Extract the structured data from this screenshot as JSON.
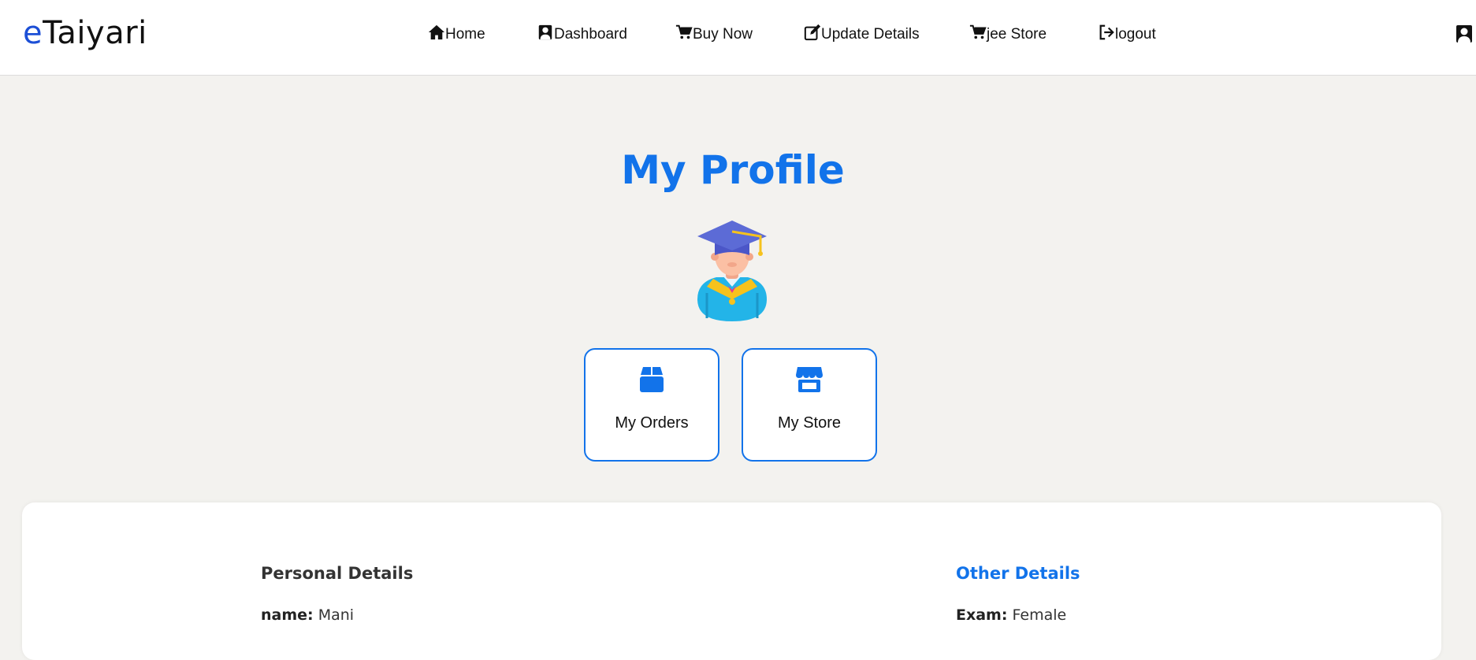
{
  "brand": {
    "logo_prefix": "e",
    "logo_rest": "Taiyari",
    "accent_color": "#1273ea",
    "logo_color": "#1c4fd6"
  },
  "nav": {
    "items": [
      {
        "label": "Home",
        "icon": "home-icon"
      },
      {
        "label": "Dashboard",
        "icon": "student-icon"
      },
      {
        "label": "Buy Now",
        "icon": "cart-icon"
      },
      {
        "label": "Update Details",
        "icon": "edit-icon"
      },
      {
        "label": "jee Store",
        "icon": "cart-icon"
      },
      {
        "label": "logout",
        "icon": "logout-icon"
      }
    ],
    "avatar_icon": "student-icon"
  },
  "profile": {
    "title": "My Profile",
    "avatar_icon": "graduate-avatar-icon"
  },
  "cards": [
    {
      "label": "My Orders",
      "icon": "box-icon"
    },
    {
      "label": "My Store",
      "icon": "store-icon"
    }
  ],
  "details": {
    "personal": {
      "heading": "Personal Details",
      "heading_color": "#333333",
      "rows": [
        {
          "key": "name:",
          "value": "Mani"
        }
      ]
    },
    "other": {
      "heading": "Other Details",
      "heading_color": "#1273ea",
      "rows": [
        {
          "key": "Exam:",
          "value": "Female"
        }
      ]
    }
  }
}
